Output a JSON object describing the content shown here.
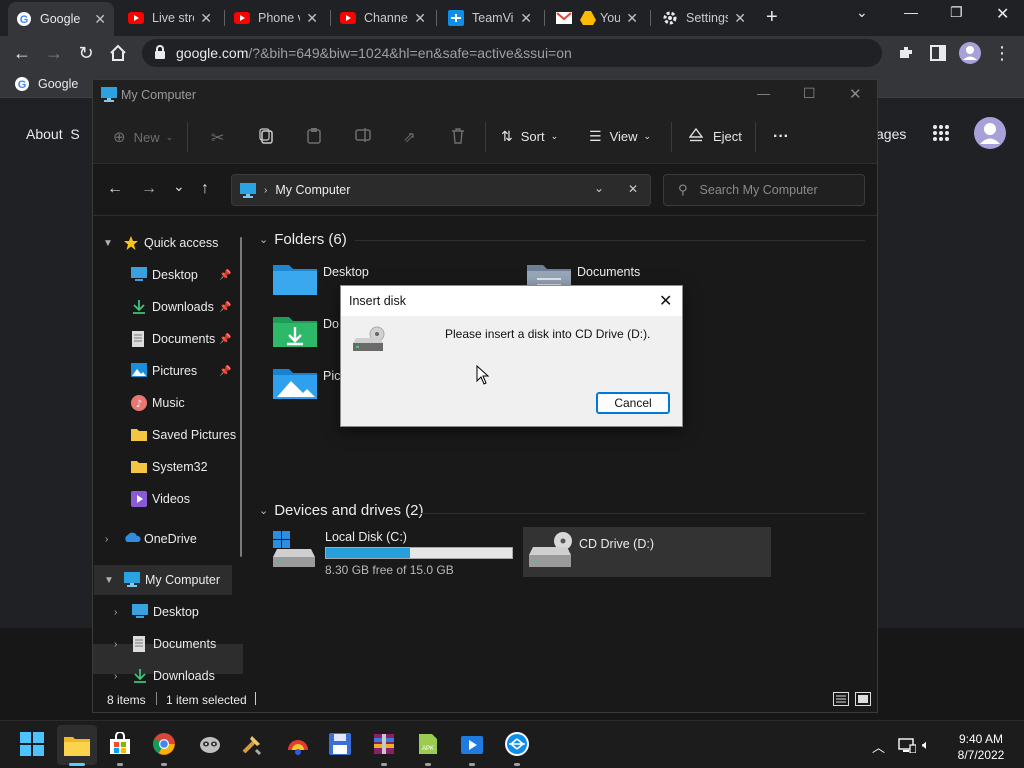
{
  "browser": {
    "tabs": [
      {
        "label": "Google",
        "icon": "google-icon",
        "active": true
      },
      {
        "label": "Live stre",
        "icon": "youtube-icon"
      },
      {
        "label": "Phone v",
        "icon": "youtube-icon"
      },
      {
        "label": "Channel",
        "icon": "youtube-icon"
      },
      {
        "label": "TeamVi",
        "icon": "teamviewer-icon"
      },
      {
        "label": "You",
        "icon": "gmail-icon"
      },
      {
        "label": "Settings",
        "icon": "gear-icon"
      }
    ],
    "new_tab": "+",
    "url_host": "google.com",
    "url_rest": "/?&bih=649&biw=1024&hl=en&safe=active&ssui=on",
    "bookmark": "Google"
  },
  "google_page": {
    "about": "About",
    "store_partial": "S",
    "images_partial": "ages"
  },
  "explorer": {
    "title": "My Computer",
    "commands": {
      "new": "New",
      "sort": "Sort",
      "view": "View",
      "eject": "Eject",
      "more": "···"
    },
    "address": "My Computer",
    "search_placeholder": "Search My Computer",
    "nav": [
      {
        "label": "Quick access",
        "icon": "star-icon",
        "level": 0,
        "chev": "v"
      },
      {
        "label": "Desktop",
        "icon": "desktop-folder-icon",
        "level": 1,
        "pin": true
      },
      {
        "label": "Downloads",
        "icon": "download-icon",
        "level": 1,
        "pin": true
      },
      {
        "label": "Documents",
        "icon": "document-icon",
        "level": 1,
        "pin": true
      },
      {
        "label": "Pictures",
        "icon": "pictures-icon",
        "level": 1,
        "pin": true
      },
      {
        "label": "Music",
        "icon": "music-icon",
        "level": 1
      },
      {
        "label": "Saved Pictures",
        "icon": "folder-icon",
        "level": 1
      },
      {
        "label": "System32",
        "icon": "folder-icon",
        "level": 1
      },
      {
        "label": "Videos",
        "icon": "videos-icon",
        "level": 1
      },
      {
        "label": "OneDrive",
        "icon": "onedrive-icon",
        "level": 0,
        "chev": ">"
      },
      {
        "label": "My Computer",
        "icon": "computer-icon",
        "level": 0,
        "chev": "v",
        "selected": true
      },
      {
        "label": "Desktop",
        "icon": "desktop-folder-icon",
        "level": 1,
        "chev": ">"
      },
      {
        "label": "Documents",
        "icon": "document-icon",
        "level": 1,
        "chev": ">"
      },
      {
        "label": "Downloads",
        "icon": "download-icon",
        "level": 1,
        "chev": ">"
      }
    ],
    "folders_header": "Folders (6)",
    "folders": [
      "Desktop",
      "Documents",
      "Do",
      "Pic"
    ],
    "devices_header": "Devices and drives (2)",
    "drives": [
      {
        "label": "Local Disk (C:)",
        "free": "8.30 GB free of 15.0 GB",
        "used_fraction": 0.45
      },
      {
        "label": "CD Drive (D:)"
      }
    ],
    "status": {
      "items": "8 items",
      "selected": "1 item selected"
    }
  },
  "dialog": {
    "title": "Insert disk",
    "message": "Please insert a disk into CD Drive (D:).",
    "cancel": "Cancel"
  },
  "taskbar": {
    "time": "9:40 AM",
    "date": "8/7/2022"
  }
}
